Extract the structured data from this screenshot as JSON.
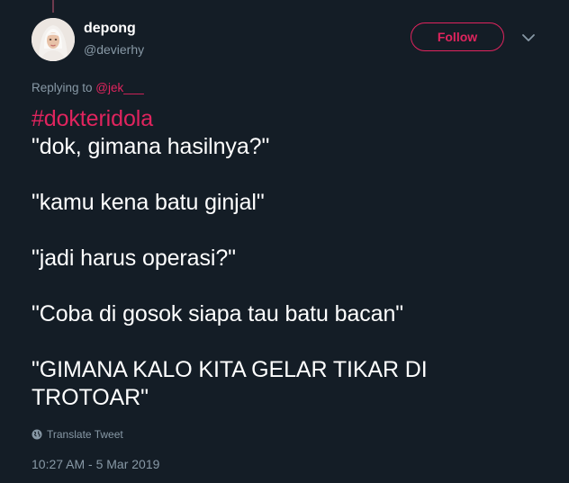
{
  "user": {
    "display_name": "depong",
    "handle": "@devierhy"
  },
  "follow_button": {
    "label": "Follow"
  },
  "icons": {
    "options": "chevron-down-icon",
    "translate": "globe-icon"
  },
  "colors": {
    "background": "#141d26",
    "accent": "#e0245e",
    "muted_text": "#8899a6"
  },
  "reply": {
    "prefix": "Replying to ",
    "mention": "@jek___"
  },
  "tweet": {
    "hashtag": "#dokteridola",
    "line1": "\"dok, gimana hasilnya?\"",
    "line2": "\"kamu kena batu ginjal\"",
    "line3": "\"jadi harus operasi?\"",
    "line4": "\"Coba di gosok siapa tau batu bacan\"",
    "line5a": "\"GIMANA KALO KITA GELAR TIKAR DI",
    "line5b": "TROTOAR\""
  },
  "translate_label": "Translate Tweet",
  "timestamp": "10:27 AM - 5 Mar 2019"
}
